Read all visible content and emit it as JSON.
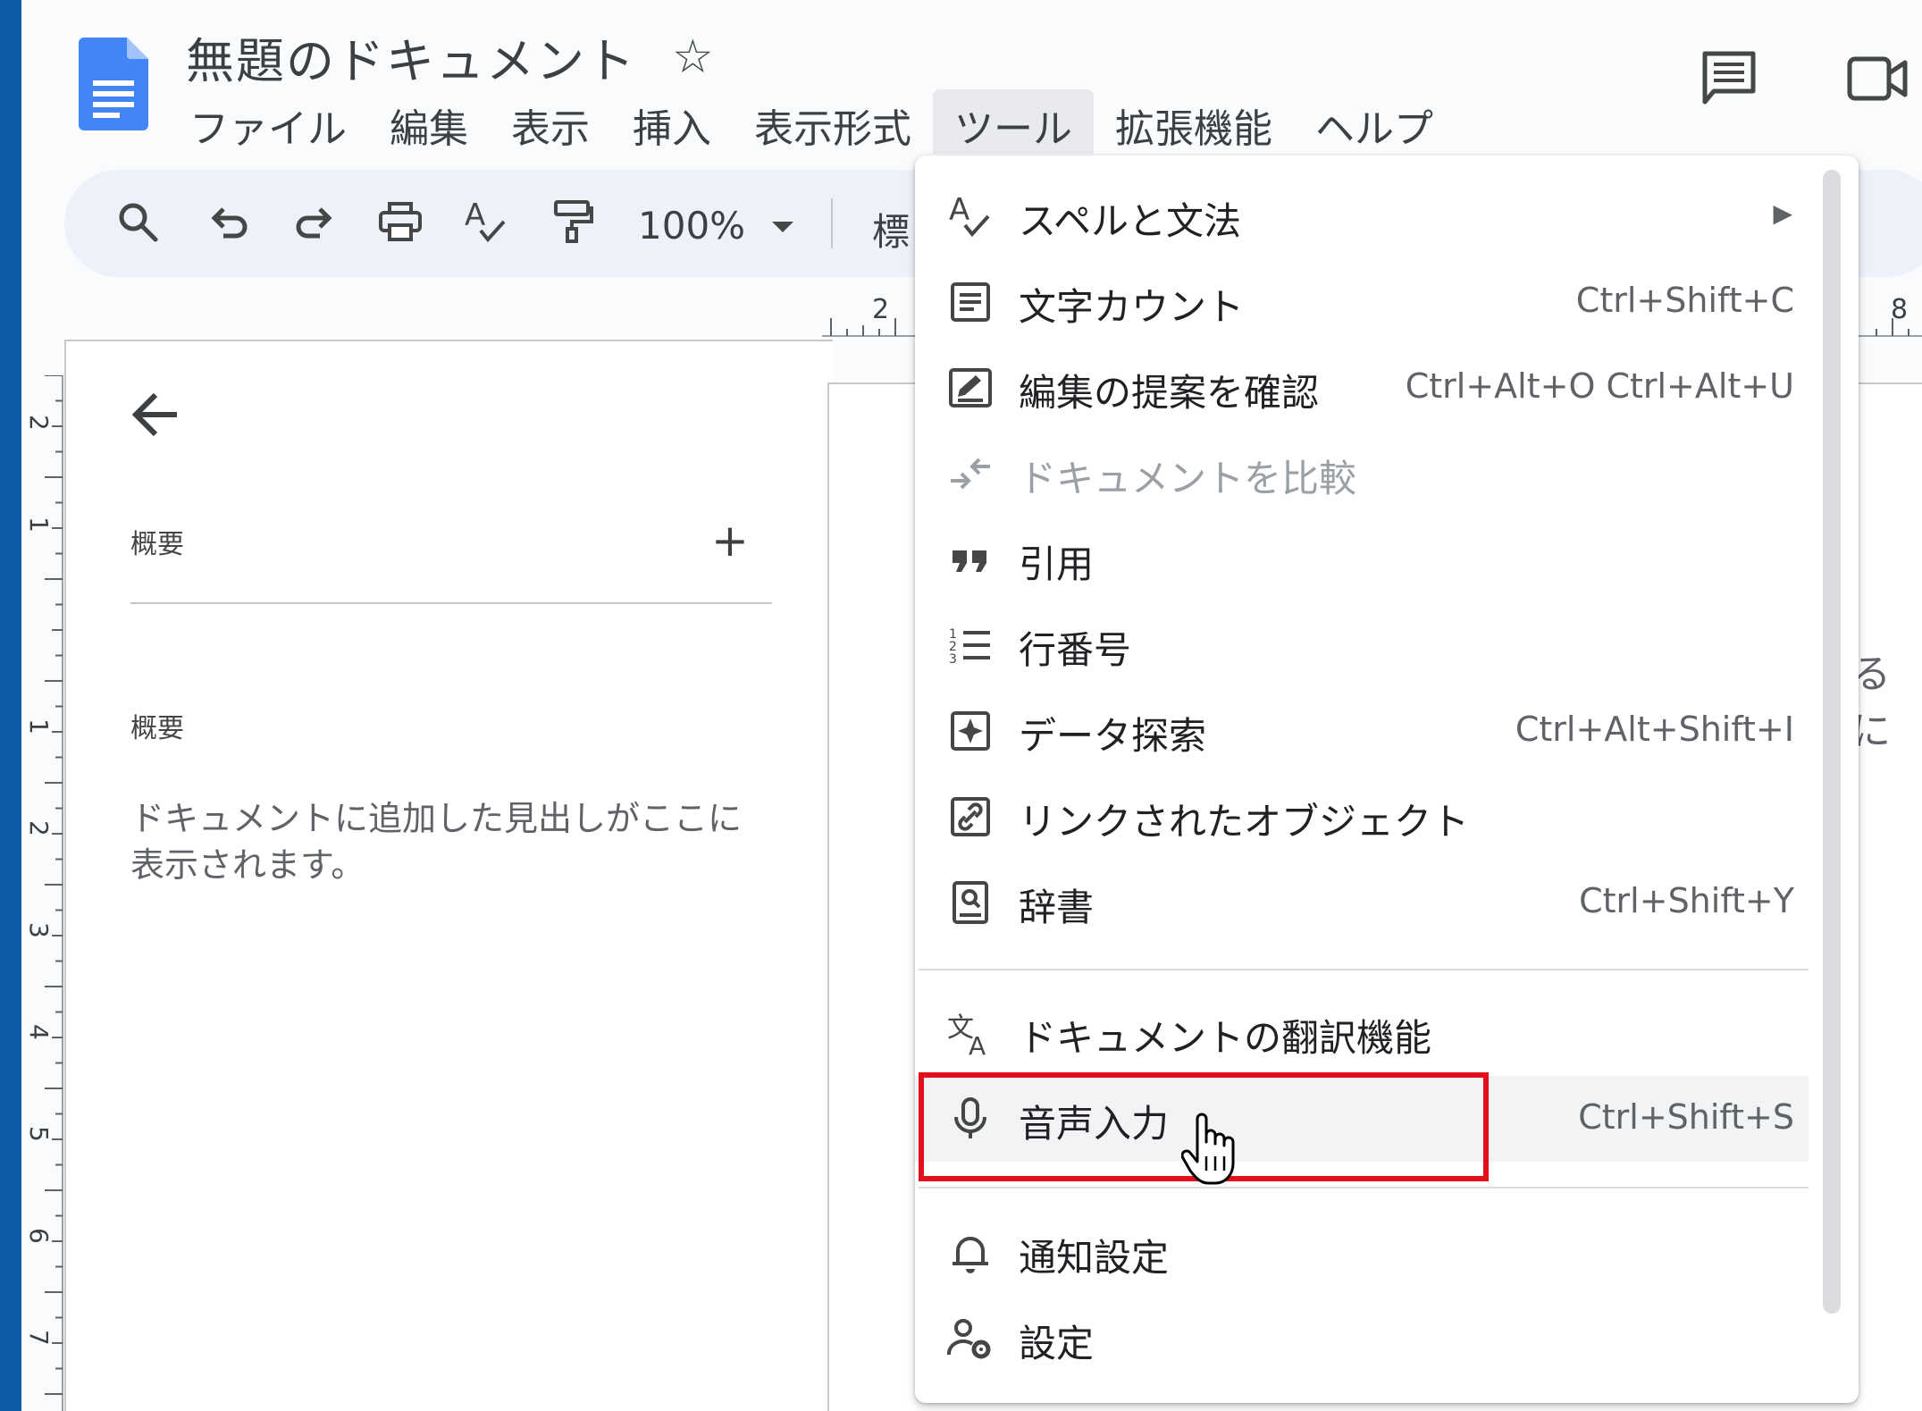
{
  "document": {
    "title": "無題のドキュメント"
  },
  "menubar": [
    {
      "id": "file",
      "label": "ファイル"
    },
    {
      "id": "edit",
      "label": "編集"
    },
    {
      "id": "view",
      "label": "表示"
    },
    {
      "id": "insert",
      "label": "挿入"
    },
    {
      "id": "format",
      "label": "表示形式"
    },
    {
      "id": "tools",
      "label": "ツール",
      "active": true
    },
    {
      "id": "extensions",
      "label": "拡張機能"
    },
    {
      "id": "help",
      "label": "ヘルプ"
    }
  ],
  "toolbar": {
    "zoom": "100%",
    "style_partial": "標",
    "icons": [
      "search-icon",
      "undo-icon",
      "redo-icon",
      "print-icon",
      "spellcheck-icon",
      "paint-format-icon"
    ]
  },
  "ruler": {
    "horizontal": [
      "2",
      "8"
    ],
    "vertical": [
      "2",
      "1",
      "1",
      "2",
      "3",
      "4",
      "5",
      "6",
      "7"
    ]
  },
  "outline": {
    "summary_label": "概要",
    "outline_label": "概要",
    "add_symbol": "+",
    "hint": "ドキュメントに追加した見出しがここに表示されます。"
  },
  "page_peek_text": "るに",
  "tools_menu": {
    "items": [
      {
        "label": "スペルと文法",
        "icon": "spellcheck-icon",
        "submenu": true,
        "arrow": "▶"
      },
      {
        "label": "文字カウント",
        "icon": "word-count-icon",
        "shortcut": "Ctrl+Shift+C"
      },
      {
        "label": "編集の提案を確認",
        "icon": "review-edits-icon",
        "shortcut": "Ctrl+Alt+O Ctrl+Alt+U"
      },
      {
        "label": "ドキュメントを比較",
        "icon": "compare-icon",
        "disabled": true
      },
      {
        "label": "引用",
        "icon": "quote-icon"
      },
      {
        "label": "行番号",
        "icon": "line-numbers-icon"
      },
      {
        "label": "データ探索",
        "icon": "explore-icon",
        "shortcut": "Ctrl+Alt+Shift+I"
      },
      {
        "label": "リンクされたオブジェクト",
        "icon": "linked-objects-icon"
      },
      {
        "label": "辞書",
        "icon": "dictionary-icon",
        "shortcut": "Ctrl+Shift+Y"
      },
      {
        "label": "ドキュメントの翻訳機能",
        "icon": "translate-icon"
      },
      {
        "label": "音声入力",
        "icon": "microphone-icon",
        "shortcut": "Ctrl+Shift+S",
        "highlighted": true
      },
      {
        "label": "通知設定",
        "icon": "bell-icon"
      },
      {
        "label": "設定",
        "icon": "settings-icon"
      }
    ]
  },
  "colors": {
    "accent_blue": "#1a73e8",
    "doc_logo": "#4285f4",
    "highlight_border": "#e1101a",
    "toolbar_bg": "#edf2fa"
  }
}
